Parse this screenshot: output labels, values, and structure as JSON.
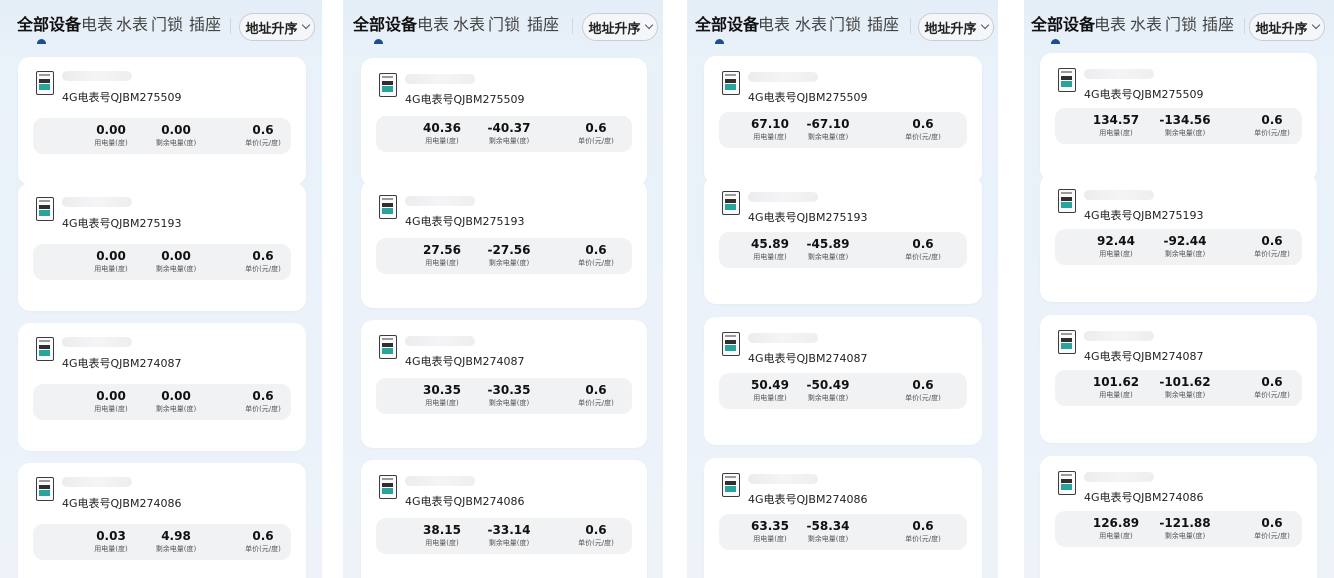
{
  "tabs": [
    {
      "label": "全部设备",
      "active": true
    },
    {
      "label": "电表",
      "active": false
    },
    {
      "label": "水表",
      "active": false
    },
    {
      "label": "门锁",
      "active": false
    },
    {
      "label": "插座",
      "active": false
    }
  ],
  "sort_label": "地址升序",
  "stat_labels": {
    "used": "用电量(度)",
    "remaining": "剩余电量(度)",
    "price": "单价(元/度)"
  },
  "icons": {
    "device": "electric-meter-icon",
    "sort": "chevron-down-icon"
  },
  "colors": {
    "accent": "#1d4f8f",
    "meter_band": "#2aa49a",
    "stats_bg": "#f1f2f4"
  },
  "screens": [
    {
      "devices": [
        {
          "number": "4G电表号QJBM275509",
          "used": "0.00",
          "remaining": "0.00",
          "price": "0.6"
        },
        {
          "number": "4G电表号QJBM275193",
          "used": "0.00",
          "remaining": "0.00",
          "price": "0.6"
        },
        {
          "number": "4G电表号QJBM274087",
          "used": "0.00",
          "remaining": "0.00",
          "price": "0.6"
        },
        {
          "number": "4G电表号QJBM274086",
          "used": "0.03",
          "remaining": "4.98",
          "price": "0.6"
        }
      ]
    },
    {
      "devices": [
        {
          "number": "4G电表号QJBM275509",
          "used": "40.36",
          "remaining": "-40.37",
          "price": "0.6"
        },
        {
          "number": "4G电表号QJBM275193",
          "used": "27.56",
          "remaining": "-27.56",
          "price": "0.6"
        },
        {
          "number": "4G电表号QJBM274087",
          "used": "30.35",
          "remaining": "-30.35",
          "price": "0.6"
        },
        {
          "number": "4G电表号QJBM274086",
          "used": "38.15",
          "remaining": "-33.14",
          "price": "0.6"
        }
      ]
    },
    {
      "devices": [
        {
          "number": "4G电表号QJBM275509",
          "used": "67.10",
          "remaining": "-67.10",
          "price": "0.6"
        },
        {
          "number": "4G电表号QJBM275193",
          "used": "45.89",
          "remaining": "-45.89",
          "price": "0.6"
        },
        {
          "number": "4G电表号QJBM274087",
          "used": "50.49",
          "remaining": "-50.49",
          "price": "0.6"
        },
        {
          "number": "4G电表号QJBM274086",
          "used": "63.35",
          "remaining": "-58.34",
          "price": "0.6"
        }
      ]
    },
    {
      "devices": [
        {
          "number": "4G电表号QJBM275509",
          "used": "134.57",
          "remaining": "-134.56",
          "price": "0.6"
        },
        {
          "number": "4G电表号QJBM275193",
          "used": "92.44",
          "remaining": "-92.44",
          "price": "0.6"
        },
        {
          "number": "4G电表号QJBM274087",
          "used": "101.62",
          "remaining": "-101.62",
          "price": "0.6"
        },
        {
          "number": "4G电表号QJBM274086",
          "used": "126.89",
          "remaining": "-121.88",
          "price": "0.6"
        }
      ]
    }
  ]
}
